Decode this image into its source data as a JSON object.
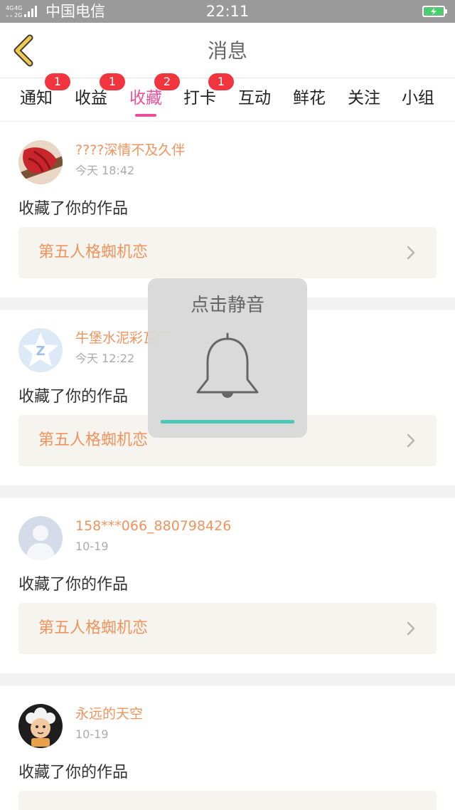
{
  "status_bar": {
    "network_indicator": "4G 2G",
    "carrier": "中国电信",
    "time": "22:11",
    "battery_icon": "battery-charging-icon"
  },
  "header": {
    "back_icon": "chevron-left-icon",
    "title": "消息"
  },
  "tabs": [
    {
      "label": "通知",
      "badge": "1",
      "active": false
    },
    {
      "label": "收益",
      "badge": "1",
      "active": false
    },
    {
      "label": "收藏",
      "badge": "2",
      "active": true
    },
    {
      "label": "打卡",
      "badge": "1",
      "active": false
    },
    {
      "label": "互动",
      "badge": "",
      "active": false
    },
    {
      "label": "鲜花",
      "badge": "",
      "active": false
    },
    {
      "label": "关注",
      "badge": "",
      "active": false
    },
    {
      "label": "小组",
      "badge": "",
      "active": false
    }
  ],
  "messages": [
    {
      "username": "????深情不及久伴",
      "time": "今天 18:42",
      "action": "收藏了你的作品",
      "work_title": "第五人格蜘机恋"
    },
    {
      "username": "牛堡水泥彩瓦厂",
      "time": "今天 12:22",
      "action": "收藏了你的作品",
      "work_title": "第五人格蜘机恋"
    },
    {
      "username": "158***066_880798426",
      "time": "10-19",
      "action": "收藏了你的作品",
      "work_title": "第五人格蜘机恋"
    },
    {
      "username": "永远的天空",
      "time": "10-19",
      "action": "收藏了你的作品",
      "work_title": ""
    }
  ],
  "toast": {
    "text": "点击静音",
    "icon": "bell-icon"
  },
  "colors": {
    "accent_pink": "#ec4f9a",
    "username_orange": "#f0935c",
    "badge_red": "#f1353f",
    "teal_bar": "#4bc7b4",
    "back_arrow_yellow": "#f2c94c"
  }
}
